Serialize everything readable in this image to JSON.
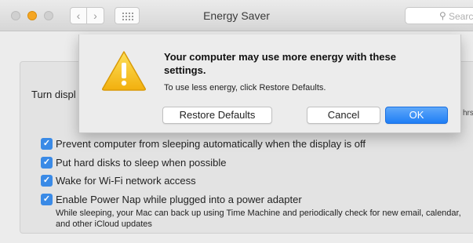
{
  "window": {
    "title": "Energy Saver",
    "search_placeholder": "Search"
  },
  "nav": {
    "back": "‹",
    "forward": "›"
  },
  "content": {
    "turn_display_label": "Turn displ",
    "hrs_label": "hrs",
    "options": [
      {
        "label": "Prevent computer from sleeping automatically when the display is off",
        "checked": true
      },
      {
        "label": "Put hard disks to sleep when possible",
        "checked": true
      },
      {
        "label": "Wake for Wi-Fi network access",
        "checked": true
      },
      {
        "label": "Enable Power Nap while plugged into a power adapter",
        "checked": true
      }
    ],
    "power_nap_description": "While sleeping, your Mac can back up using Time Machine and periodically check for new email, calendar, and other iCloud updates"
  },
  "alert": {
    "heading": "Your computer may use more energy with these settings.",
    "message": "To use less energy, click Restore Defaults.",
    "buttons": {
      "restore": "Restore Defaults",
      "cancel": "Cancel",
      "ok": "OK"
    }
  },
  "colors": {
    "accent": "#1f7ef5",
    "checkbox": "#3a8ae6",
    "warning": "#f5c518"
  }
}
